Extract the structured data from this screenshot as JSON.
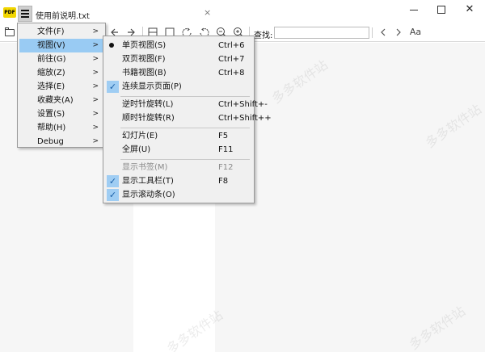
{
  "titlebar": {
    "logo_text": "PDF",
    "tab_title": "使用前说明.txt",
    "tab_close": "×",
    "close_glyph": "✕"
  },
  "toolbar": {
    "search_label": "查找:",
    "search_value": "",
    "icons": [
      "folder-icon",
      "back-icon",
      "forward-icon",
      "single-page-icon",
      "fit-page-icon",
      "rotate-ccw-icon",
      "rotate-cw-icon",
      "zoom-out-icon",
      "zoom-in-icon",
      "search-prev-icon",
      "search-next-icon",
      "match-case-icon"
    ],
    "match_case_label": "Aa"
  },
  "main_menu": {
    "items": [
      {
        "label": "文件(F)",
        "has_submenu": true
      },
      {
        "label": "视图(V)",
        "has_submenu": true,
        "highlighted": true
      },
      {
        "label": "前往(G)",
        "has_submenu": true
      },
      {
        "label": "缩放(Z)",
        "has_submenu": true
      },
      {
        "label": "选择(E)",
        "has_submenu": true
      },
      {
        "label": "收藏夹(A)",
        "has_submenu": true
      },
      {
        "label": "设置(S)",
        "has_submenu": true
      },
      {
        "label": "帮助(H)",
        "has_submenu": true
      },
      {
        "label": "Debug",
        "has_submenu": true
      }
    ],
    "arrow": ">"
  },
  "view_menu": {
    "items": [
      {
        "label": "单页视图(S)",
        "shortcut": "Ctrl+6",
        "mark": "bullet"
      },
      {
        "label": "双页视图(F)",
        "shortcut": "Ctrl+7",
        "mark": ""
      },
      {
        "label": "书籍视图(B)",
        "shortcut": "Ctrl+8",
        "mark": ""
      },
      {
        "label": "连续显示页面(P)",
        "shortcut": "",
        "mark": "check"
      },
      {
        "label": "逆时针旋转(L)",
        "shortcut": "Ctrl+Shift+-",
        "mark": ""
      },
      {
        "label": "顺时针旋转(R)",
        "shortcut": "Ctrl+Shift++",
        "mark": ""
      },
      {
        "label": "幻灯片(E)",
        "shortcut": "F5",
        "mark": ""
      },
      {
        "label": "全屏(U)",
        "shortcut": "F11",
        "mark": ""
      },
      {
        "label": "显示书签(M)",
        "shortcut": "F12",
        "mark": "",
        "disabled": true
      },
      {
        "label": "显示工具栏(T)",
        "shortcut": "F8",
        "mark": "check"
      },
      {
        "label": "显示滚动条(O)",
        "shortcut": "",
        "mark": "check"
      }
    ],
    "check_glyph": "✓"
  },
  "colors": {
    "highlight": "#99cbf3",
    "check_bg": "#9fcdf3",
    "menu_bg": "#f0f0f0",
    "doc_bg": "#f6f6f6"
  },
  "watermark_text": "多多软件站"
}
